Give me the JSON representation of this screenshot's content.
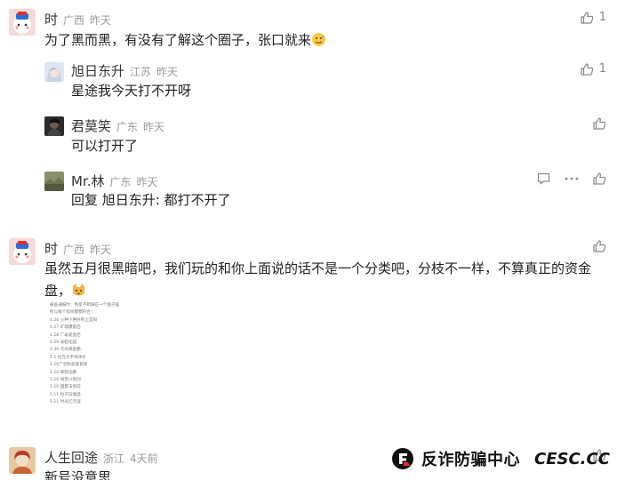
{
  "comments": [
    {
      "name": "时",
      "location": "广西",
      "time": "昨天",
      "text": "为了黑而黑，有没有了解这个圈子，张口就来",
      "likes": "1"
    },
    {
      "name": "旭日东升",
      "location": "江苏",
      "time": "昨天",
      "text": "星途我今天打不开呀",
      "likes": "1"
    },
    {
      "name": "君莫笑",
      "location": "广东",
      "time": "昨天",
      "text": "可以打开了"
    },
    {
      "name": "Mr.林",
      "location": "广东",
      "time": "昨天",
      "reply_prefix": "回复",
      "reply_to": "旭日东升",
      "text": ":  都打不开了"
    },
    {
      "name": "时",
      "location": "广西",
      "time": "昨天",
      "text": "虽然五月很黑暗吧，我们玩的和你上面说的话不是一个分类吧，分枝不一样，不算真正的资金盘，",
      "image_lines": [
        "被查通报时：熊星不断踩在一个盘子里",
        "所以每个指纹都都符合：",
        "4.26 火种小惠好师止是阳",
        "4.27 矿魂爆雷后",
        "4.28 广泰爱蛋后",
        "4.29 泰铂化园",
        "4.30 元光跑金鹏",
        "5.1 社元大手地冲价",
        "5.10广恐秋益着套建",
        "5.10 率辖法鹏",
        "5.10 如晋以划创",
        "5.10 国夏法到前",
        "5.11 恒子白魂温",
        "5.11 时光忆元强"
      ]
    },
    {
      "name": "人生回途",
      "location": "浙江",
      "time": "4天前",
      "text": "新号没意思"
    }
  ],
  "watermark": {
    "chinese": "反诈防骗中心",
    "english": "CESC.CC"
  },
  "colors": {
    "meta_gray": "#9a9a9a",
    "icon_gray": "#888888",
    "text": "#222222"
  }
}
